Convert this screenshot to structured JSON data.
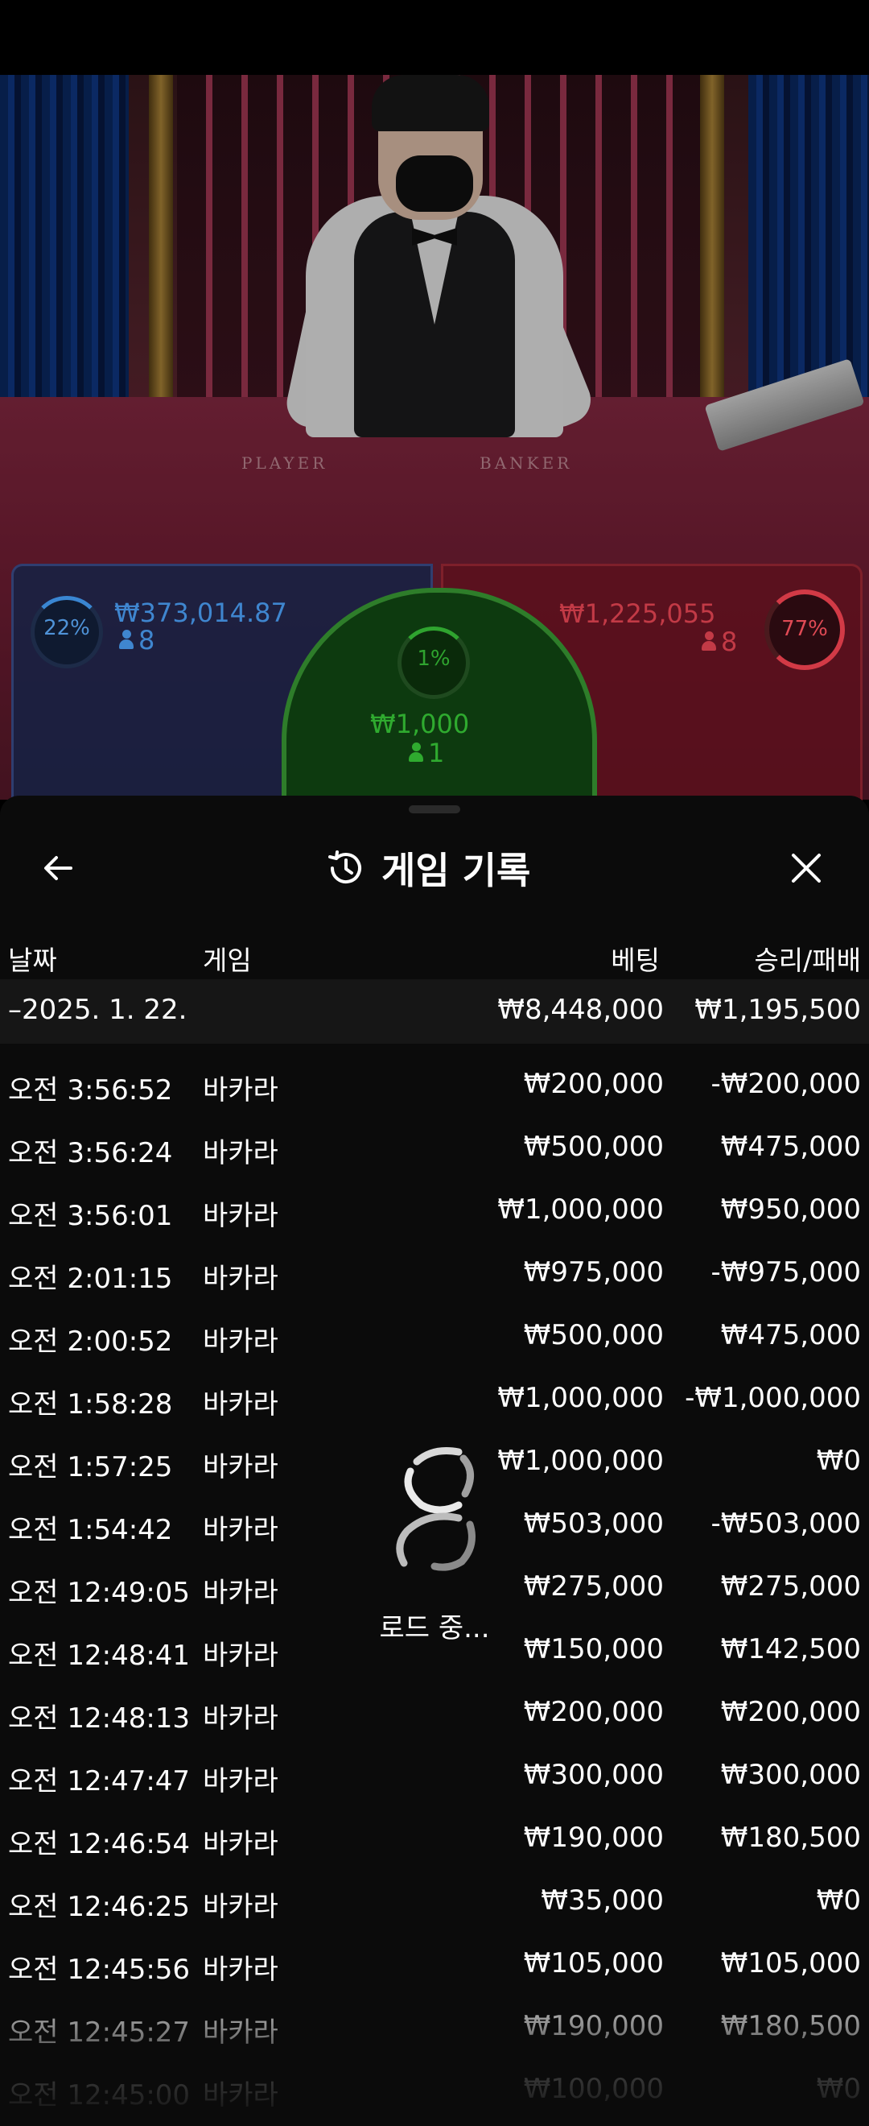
{
  "video": {
    "table_labels": {
      "player": "PLAYER",
      "banker": "BANKER"
    }
  },
  "bets": {
    "player": {
      "percent": "22%",
      "amount": "₩373,014.87",
      "players": "8",
      "color": "#3a86d2"
    },
    "tie": {
      "percent": "1%",
      "amount": "₩1,000",
      "players": "1",
      "color": "#2fa42f"
    },
    "banker": {
      "percent": "77%",
      "amount": "₩1,225,055",
      "players": "8",
      "color": "#d23a46"
    }
  },
  "history": {
    "title": "게임 기록",
    "back_icon": "arrow-left-icon",
    "close_icon": "close-icon",
    "history_icon": "history-icon",
    "columns": {
      "date": "날짜",
      "game": "게임",
      "bet": "베팅",
      "result": "승리/패배"
    },
    "date_group": {
      "date": "–2025. 1. 22.",
      "total_bet": "₩8,448,000",
      "total_result": "₩1,195,500"
    },
    "rows": [
      {
        "time": "오전 3:56:52",
        "game": "바카라",
        "bet": "₩200,000",
        "result": "-₩200,000"
      },
      {
        "time": "오전 3:56:24",
        "game": "바카라",
        "bet": "₩500,000",
        "result": "₩475,000"
      },
      {
        "time": "오전 3:56:01",
        "game": "바카라",
        "bet": "₩1,000,000",
        "result": "₩950,000"
      },
      {
        "time": "오전 2:01:15",
        "game": "바카라",
        "bet": "₩975,000",
        "result": "-₩975,000"
      },
      {
        "time": "오전 2:00:52",
        "game": "바카라",
        "bet": "₩500,000",
        "result": "₩475,000"
      },
      {
        "time": "오전 1:58:28",
        "game": "바카라",
        "bet": "₩1,000,000",
        "result": "-₩1,000,000"
      },
      {
        "time": "오전 1:57:25",
        "game": "바카라",
        "bet": "₩1,000,000",
        "result": "₩0"
      },
      {
        "time": "오전 1:54:42",
        "game": "바카라",
        "bet": "₩503,000",
        "result": "-₩503,000"
      },
      {
        "time": "오전 12:49:05",
        "game": "바카라",
        "bet": "₩275,000",
        "result": "₩275,000"
      },
      {
        "time": "오전 12:48:41",
        "game": "바카라",
        "bet": "₩150,000",
        "result": "₩142,500"
      },
      {
        "time": "오전 12:48:13",
        "game": "바카라",
        "bet": "₩200,000",
        "result": "₩200,000"
      },
      {
        "time": "오전 12:47:47",
        "game": "바카라",
        "bet": "₩300,000",
        "result": "₩300,000"
      },
      {
        "time": "오전 12:46:54",
        "game": "바카라",
        "bet": "₩190,000",
        "result": "₩180,500"
      },
      {
        "time": "오전 12:46:25",
        "game": "바카라",
        "bet": "₩35,000",
        "result": "₩0"
      },
      {
        "time": "오전 12:45:56",
        "game": "바카라",
        "bet": "₩105,000",
        "result": "₩105,000"
      },
      {
        "time": "오전 12:45:27",
        "game": "바카라",
        "bet": "₩190,000",
        "result": "₩180,500"
      },
      {
        "time": "오전 12:45:00",
        "game": "바카라",
        "bet": "₩100,000",
        "result": "₩0"
      }
    ],
    "loading": {
      "icon": "loading-spinner-icon",
      "text": "로드 중..."
    }
  }
}
